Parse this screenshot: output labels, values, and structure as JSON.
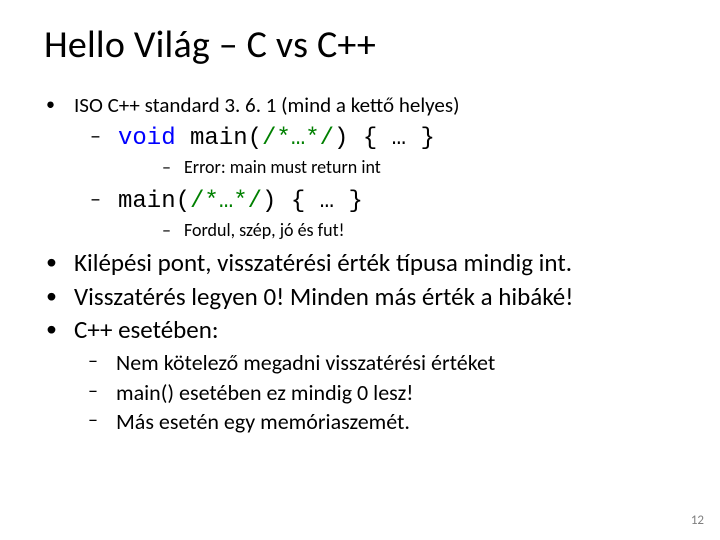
{
  "title": "Hello Világ – C vs C++",
  "b1": "ISO C++ standard 3. 6. 1 (mind a kettő helyes)",
  "code1_kw": "void",
  "code1_rest": " main(",
  "code1_cm": "/*…*/",
  "code1_tail": ") { … }",
  "err": "Error: main must return int",
  "code2_head": "main(",
  "code2_cm": "/*…*/",
  "code2_tail": ") { … }",
  "ok": "Fordul, szép, jó és fut!",
  "b2": "Kilépési pont, visszatérési érték típusa mindig int.",
  "b3": "Visszatérés legyen 0! Minden más érték a hibáké!",
  "b4": "C++ esetében:",
  "s1": "Nem kötelező megadni visszatérési értéket",
  "s2": "main() esetében ez mindig 0 lesz!",
  "s3": "Más esetén egy memóriaszemét.",
  "pagenum": "12"
}
